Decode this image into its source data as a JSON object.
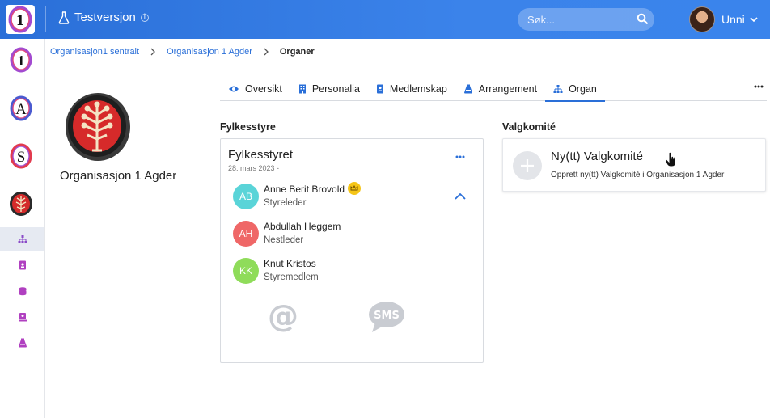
{
  "header": {
    "env_label": "Testversjon",
    "search_placeholder": "Søk...",
    "user_name": "Unni"
  },
  "sidebar": {
    "org_logos": [
      {
        "letter": "1",
        "name": "organisasjon1-logo"
      },
      {
        "letter": "A",
        "name": "a-logo"
      },
      {
        "letter": "S",
        "name": "s-logo"
      },
      {
        "letter": "",
        "name": "agder-emblem"
      }
    ],
    "nav_icons": [
      "organization-icon",
      "person-card-icon",
      "coins-icon",
      "id-badge-icon",
      "event-icon"
    ]
  },
  "breadcrumb": {
    "items": [
      "Organisasjon1 sentralt",
      "Organisasjon 1 Agder"
    ],
    "current": "Organer"
  },
  "org": {
    "name": "Organisasjon 1 Agder"
  },
  "tabs": [
    {
      "label": "Oversikt",
      "icon": "eye-icon"
    },
    {
      "label": "Personalia",
      "icon": "building-icon"
    },
    {
      "label": "Medlemskap",
      "icon": "member-card-icon"
    },
    {
      "label": "Arrangement",
      "icon": "event-icon"
    },
    {
      "label": "Organ",
      "icon": "organization-icon",
      "active": true
    }
  ],
  "fylkesstyre": {
    "section_title": "Fylkesstyre",
    "card_title": "Fylkesstyret",
    "date": "28. mars 2023 -",
    "members": [
      {
        "initials": "AB",
        "name": "Anne Berit Brovold",
        "role": "Styreleder",
        "color": "#5ad4d8",
        "crown": true
      },
      {
        "initials": "AH",
        "name": "Abdullah Heggem",
        "role": "Nestleder",
        "color": "#ef6767"
      },
      {
        "initials": "KK",
        "name": "Knut Kristos",
        "role": "Styremedlem",
        "color": "#8fdc5a"
      }
    ],
    "sms_label": "SMS"
  },
  "valgkomite": {
    "section_title": "Valgkomité",
    "new_title": "Ny(tt) Valgkomité",
    "new_sub": "Opprett ny(tt) Valgkomité i Organisasjon 1 Agder"
  },
  "colors": {
    "accent": "#2a6fd8",
    "topbar": "#3b83ea",
    "active_nav": "#e6eaf2",
    "icon_purple": "#b040c0"
  }
}
